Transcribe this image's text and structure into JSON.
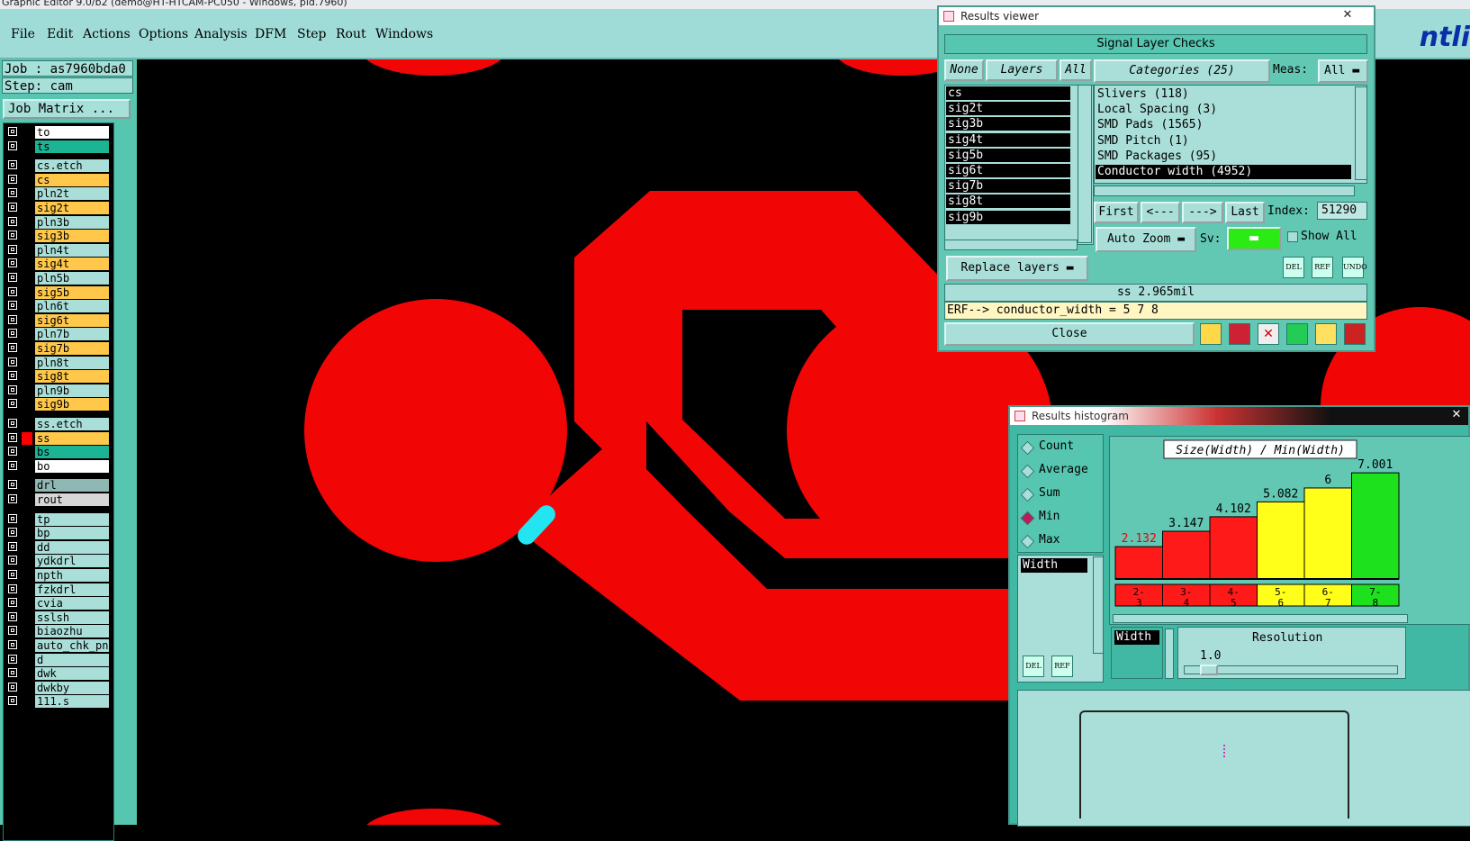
{
  "window": {
    "title": "Graphic Editor 9.0/b2 (demo@HT-HTCAM-PC050 - Windows, pid.7960)"
  },
  "menu": [
    "File",
    "Edit",
    "Actions",
    "Options",
    "Analysis",
    "DFM",
    "Step",
    "Rout",
    "Windows"
  ],
  "brand": "ntli",
  "left_panel": {
    "job": "Job : as7960bda0",
    "step": "Step: cam",
    "job_matrix": "Job Matrix ...",
    "layers": [
      {
        "name": "to",
        "color": "#ffffff",
        "swatch": "#000000"
      },
      {
        "name": "ts",
        "color": "#1bb596",
        "swatch": "#000000"
      },
      {
        "name": "cs.etch",
        "color": "#a9dfd8",
        "swatch": "#000000"
      },
      {
        "name": "cs",
        "color": "#ffc84a",
        "swatch": "#000000"
      },
      {
        "name": "pln2t",
        "color": "#a9dfd8",
        "swatch": "#000000"
      },
      {
        "name": "sig2t",
        "color": "#ffc84a",
        "swatch": "#000000"
      },
      {
        "name": "pln3b",
        "color": "#a9dfd8",
        "swatch": "#000000"
      },
      {
        "name": "sig3b",
        "color": "#ffc84a",
        "swatch": "#000000"
      },
      {
        "name": "pln4t",
        "color": "#a9dfd8",
        "swatch": "#000000"
      },
      {
        "name": "sig4t",
        "color": "#ffc84a",
        "swatch": "#000000"
      },
      {
        "name": "pln5b",
        "color": "#a9dfd8",
        "swatch": "#000000"
      },
      {
        "name": "sig5b",
        "color": "#ffc84a",
        "swatch": "#000000"
      },
      {
        "name": "pln6t",
        "color": "#a9dfd8",
        "swatch": "#000000"
      },
      {
        "name": "sig6t",
        "color": "#ffc84a",
        "swatch": "#000000"
      },
      {
        "name": "pln7b",
        "color": "#a9dfd8",
        "swatch": "#000000"
      },
      {
        "name": "sig7b",
        "color": "#ffc84a",
        "swatch": "#000000"
      },
      {
        "name": "pln8t",
        "color": "#a9dfd8",
        "swatch": "#000000"
      },
      {
        "name": "sig8t",
        "color": "#ffc84a",
        "swatch": "#000000"
      },
      {
        "name": "pln9b",
        "color": "#a9dfd8",
        "swatch": "#000000"
      },
      {
        "name": "sig9b",
        "color": "#ffc84a",
        "swatch": "#000000"
      },
      {
        "name": "ss.etch",
        "color": "#a9dfd8",
        "swatch": "#000000"
      },
      {
        "name": "ss",
        "color": "#ffc84a",
        "swatch": "#ff0000"
      },
      {
        "name": "bs",
        "color": "#1bb596",
        "swatch": "#000000"
      },
      {
        "name": "bo",
        "color": "#ffffff",
        "swatch": "#000000"
      },
      {
        "name": "drl",
        "color": "#8fb7b3",
        "swatch": "#000000"
      },
      {
        "name": "rout",
        "color": "#d6d6d6",
        "swatch": "#000000"
      },
      {
        "name": "tp",
        "color": "#a9dfd8",
        "swatch": "#000000"
      },
      {
        "name": "bp",
        "color": "#a9dfd8",
        "swatch": "#000000"
      },
      {
        "name": "dd",
        "color": "#a9dfd8",
        "swatch": "#000000"
      },
      {
        "name": "ydkdrl",
        "color": "#a9dfd8",
        "swatch": "#000000"
      },
      {
        "name": "npth",
        "color": "#a9dfd8",
        "swatch": "#000000"
      },
      {
        "name": "fzkdrl",
        "color": "#a9dfd8",
        "swatch": "#000000"
      },
      {
        "name": "cvia",
        "color": "#a9dfd8",
        "swatch": "#000000"
      },
      {
        "name": "sslsh",
        "color": "#a9dfd8",
        "swatch": "#000000"
      },
      {
        "name": "biaozhu",
        "color": "#a9dfd8",
        "swatch": "#000000"
      },
      {
        "name": "auto_chk_pnl",
        "color": "#a9dfd8",
        "swatch": "#000000"
      },
      {
        "name": "d",
        "color": "#a9dfd8",
        "swatch": "#000000"
      },
      {
        "name": "dwk",
        "color": "#a9dfd8",
        "swatch": "#000000"
      },
      {
        "name": "dwkby",
        "color": "#a9dfd8",
        "swatch": "#000000"
      },
      {
        "name": "111.s",
        "color": "#a9dfd8",
        "swatch": "#000000"
      }
    ]
  },
  "results_viewer": {
    "title": "Results viewer",
    "header": "Signal Layer Checks",
    "none_btn": "None",
    "layers_btn": "Layers",
    "all_btn": "All",
    "layer_list": [
      "cs",
      "sig2t",
      "sig3b",
      "sig4t",
      "sig5b",
      "sig6t",
      "sig7b",
      "sig8t",
      "sig9b"
    ],
    "categories_label": "Categories (25)",
    "meas_label": "Meas:",
    "meas_value": "All",
    "categories": [
      "Slivers (118)",
      "Local Spacing (3)",
      "SMD Pads (1565)",
      "SMD Pitch (1)",
      "SMD Packages (95)",
      "Conductor width (4952)"
    ],
    "selected_category": "Conductor width (4952)",
    "first_btn": "First",
    "prev_btn": "<---",
    "next_btn": "--->",
    "last_btn": "Last",
    "index_label": "Index:",
    "index_value": "51290",
    "auto_zoom": "Auto Zoom",
    "sv_label": "Sv:",
    "show_all": "Show All",
    "replace_layers": "Replace layers",
    "tool_del": "DEL",
    "tool_ref": "REF",
    "tool_undo": "UNDO",
    "measure": "ss 2.965mil",
    "erf": "ERF--> conductor_width = 5 7 8",
    "close_btn": "Close"
  },
  "histogram": {
    "title": "Results histogram",
    "options": [
      "Count",
      "Average",
      "Sum",
      "Min",
      "Max"
    ],
    "selected_option": "Min",
    "list_item": "Width",
    "chart_title": "Size(Width) / Min(Width)",
    "field_label": "Width",
    "resolution_label": "Resolution",
    "resolution_value": "1.0",
    "tool_del": "DEL",
    "tool_ref": "REF",
    "bar_colors": [
      "#ff1a1a",
      "#ff1a1a",
      "#ff1a1a",
      "#ffff1a",
      "#ffff1a",
      "#1ee11e"
    ]
  },
  "chart_data": {
    "type": "bar",
    "title": "Size(Width) / Min(Width)",
    "categories": [
      "2-3",
      "3-4",
      "4-5",
      "5-6",
      "6-7",
      "7-8"
    ],
    "values": [
      2.132,
      3.147,
      4.102,
      5.082,
      6,
      7.001
    ],
    "value_labels": [
      "2.132",
      "3.147",
      "4.102",
      "5.082",
      "6",
      "7.001"
    ],
    "ylim": [
      0,
      7.6
    ],
    "grid": false
  }
}
